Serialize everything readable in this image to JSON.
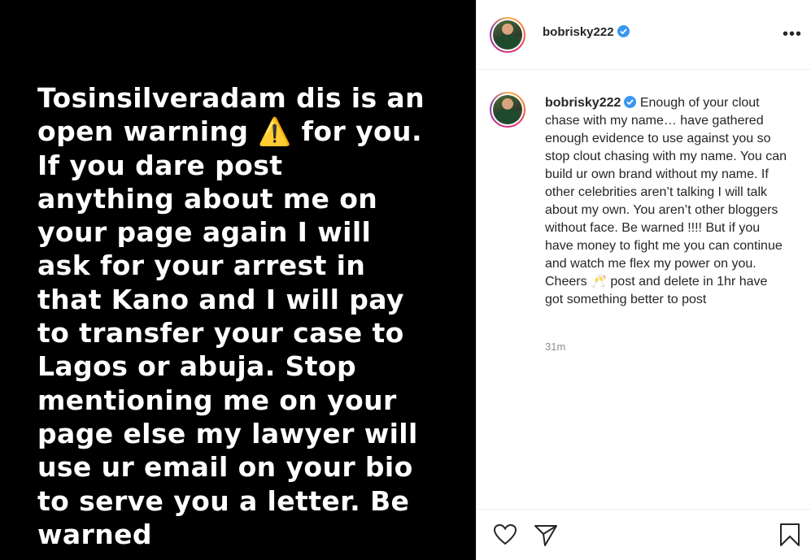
{
  "story": {
    "text": "Tosinsilveradam dis is an\nopen warning ⚠️ for you.\nIf you dare post\nanything about me on\nyour page again I will\nask for your arrest in\nthat Kano and I will pay\nto transfer your case to\nLagos or abuja. Stop\nmentioning me on your\npage else my lawyer will\nuse ur email on your bio\nto serve you a letter. Be\nwarned"
  },
  "header": {
    "username": "bobrisky222",
    "more_label": "•••"
  },
  "caption": {
    "username": "bobrisky222",
    "text": "Enough of your clout chase with my name… have gathered enough evidence to use against you so stop clout chasing with my name. You can build ur own brand without my name. If other celebrities aren’t talking I will talk about my own. You aren’t other bloggers without face. Be warned !!!! But if you have money to fight me you can continue and watch me flex my power on you. Cheers 🥂 post and delete in 1hr have got something better to post",
    "time": "31m"
  },
  "colors": {
    "verified": "#3897f0",
    "muted": "#8e8e8e",
    "text": "#262626"
  },
  "icons": [
    "heart-icon",
    "share-icon",
    "bookmark-icon",
    "verified-icon",
    "more-icon"
  ]
}
